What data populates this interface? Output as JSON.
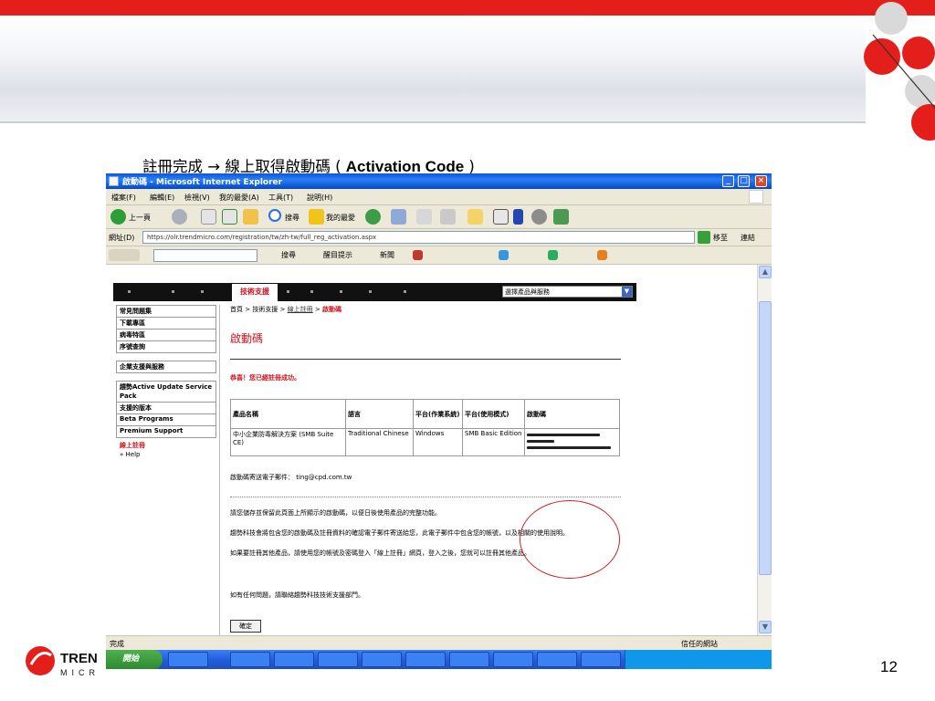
{
  "slide": {
    "title_cn": "註冊完成 → 線上取得啟動碼",
    "title_open": "(",
    "title_en": "Activation Code",
    "title_close": ")",
    "page_number": "12",
    "brand_text": "TREND MICRO",
    "colors": {
      "brand_red": "#e41f1b",
      "ellipse": "#cc2222"
    }
  },
  "browser": {
    "window_title": "啟動碼 - Microsoft Internet Explorer",
    "menu": [
      "檔案(F)",
      "編輯(E)",
      "檢視(V)",
      "我的最愛(A)",
      "工具(T)",
      "說明(H)"
    ],
    "toolbar": {
      "back": "上一頁",
      "search": "搜尋",
      "favorites": "我的最愛"
    },
    "address_label": "網址(D)",
    "address_value": "https://olr.trendmicro.com/registration/tw/zh-tw/full_reg_activation.aspx",
    "go_label": "移至",
    "links_label": "連結",
    "links_bar": {
      "search": "搜尋",
      "highlight": "醒目提示",
      "news": "新聞"
    },
    "status_left": "完成",
    "status_right": "信任的網站",
    "start_label": "開始"
  },
  "site": {
    "nav_tab": "技術支援",
    "search_select": "選擇產品與服務",
    "side_menu": [
      "常見問題集",
      "下載專區",
      "病毒特區",
      "序號查詢",
      "企業支援與服務",
      "趨勢Active Update Service Pack",
      "支援的版本",
      "Beta Programs",
      "Premium Support"
    ],
    "side_current": "線上註冊",
    "side_help": "» Help",
    "breadcrumb": {
      "home": "首頁",
      "sep": ">",
      "support": "技術支援",
      "register": "線上註冊",
      "current": "啟動碼"
    },
    "page_title": "啟動碼",
    "success_msg": "恭喜！您已經註冊成功。",
    "table": {
      "headers": [
        "產品名稱",
        "語言",
        "平台(作業系統)",
        "平台(使用模式)",
        "啟動碼"
      ],
      "row": [
        "中小企業防毒解決方案 (SMB Suite CE)",
        "Traditional Chinese",
        "Windows",
        "SMB Basic Edition",
        ""
      ]
    },
    "email_line": "啟動碼寄送電子郵件： ting@cpd.com.tw",
    "para1": "請您儲存並保留此頁面上所顯示的啟動碼，以便日後使用產品的完整功能。",
    "para2": "趨勢科技會將包含您的啟動碼及註冊資料的確認電子郵件寄送給您，此電子郵件中包含您的帳號，以及相關的使用說明。",
    "para3": "如果要註冊其他產品，請使用您的帳號及密碼登入「線上註冊」網頁，登入之後，您就可以註冊其他產品。",
    "para4": "如有任何問題，請聯絡趨勢科技技術支援部門。",
    "done_button": "確定"
  }
}
